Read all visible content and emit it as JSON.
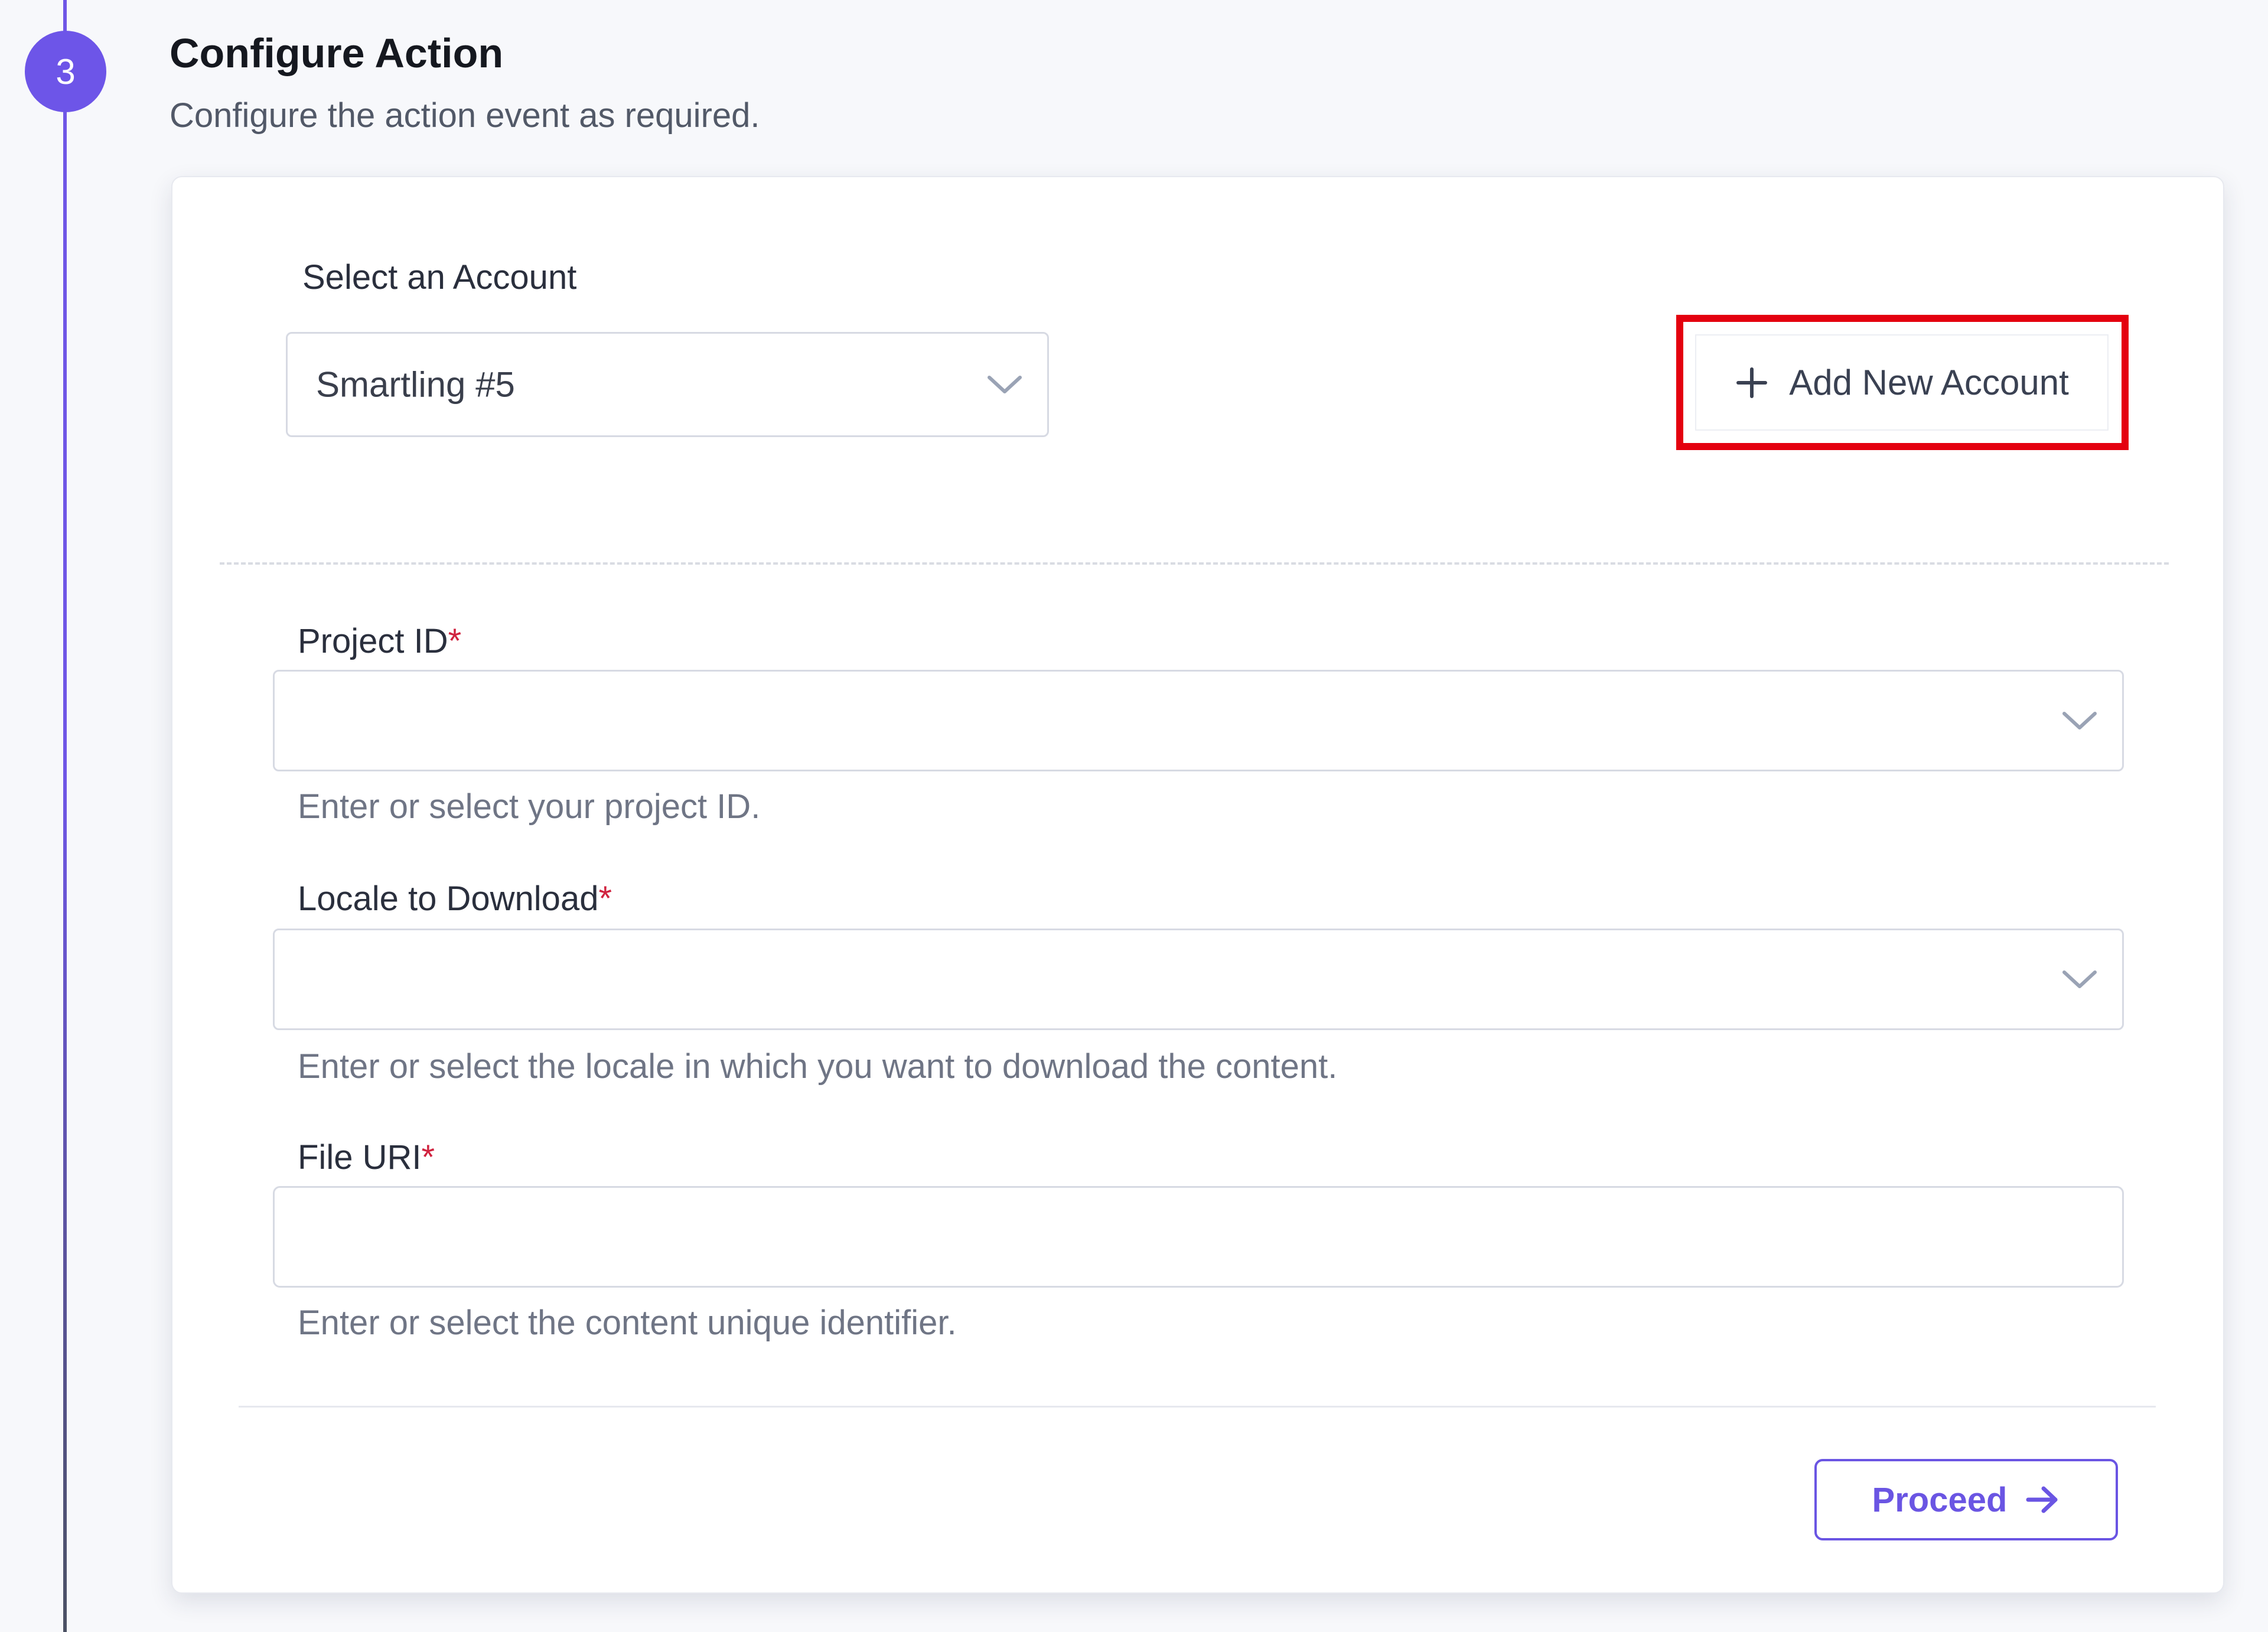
{
  "step": {
    "number": "3",
    "title": "Configure Action",
    "subtitle": "Configure the action event as required."
  },
  "account": {
    "label": "Select an Account",
    "selected": "Smartling #5",
    "add_button_label": "Add New Account"
  },
  "fields": {
    "project_id": {
      "label": "Project ID",
      "required_mark": "*",
      "value": "",
      "help": "Enter or select your project ID."
    },
    "locale": {
      "label": "Locale to Download",
      "required_mark": "*",
      "value": "",
      "help": "Enter or select the locale in which you want to download the content."
    },
    "file_uri": {
      "label": "File URI",
      "required_mark": "*",
      "value": "",
      "help": "Enter or select the content unique identifier."
    }
  },
  "actions": {
    "proceed_label": "Proceed"
  },
  "colors": {
    "accent": "#6d55e8",
    "highlight": "#e4000f",
    "required": "#d0233f"
  },
  "icons": [
    "chevron-down-icon",
    "plus-icon",
    "arrow-right-icon"
  ]
}
